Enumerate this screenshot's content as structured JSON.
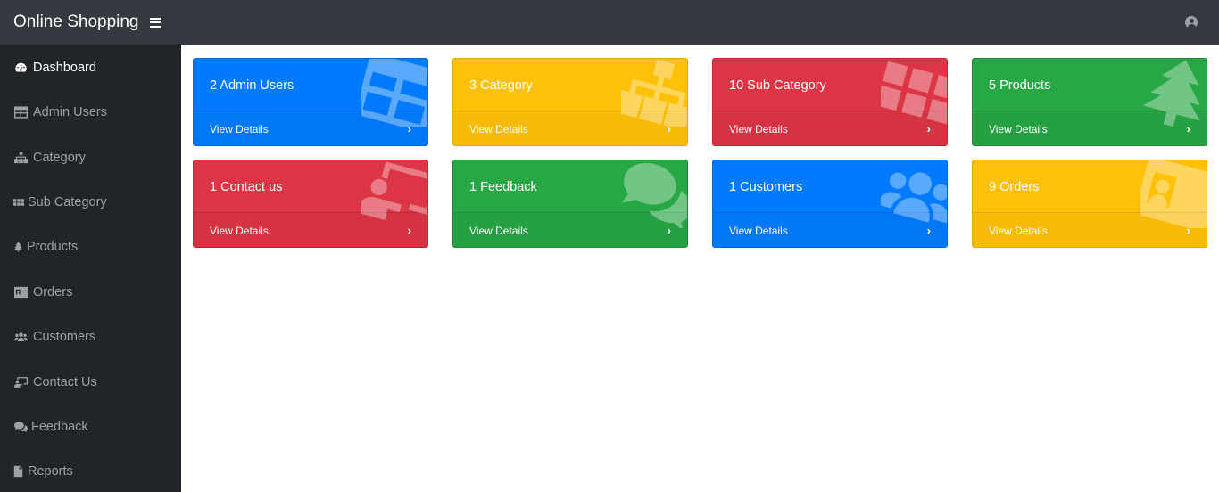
{
  "header": {
    "brand": "Online Shopping"
  },
  "sidebar": {
    "items": [
      {
        "label": "Dashboard",
        "icon": "tachometer-icon",
        "active": true
      },
      {
        "label": "Admin Users",
        "icon": "table-icon"
      },
      {
        "label": "Category",
        "icon": "sitemap-icon"
      },
      {
        "label": "Sub Category",
        "icon": "th-icon"
      },
      {
        "label": "Products",
        "icon": "tree-icon"
      },
      {
        "label": "Orders",
        "icon": "id-card-icon"
      },
      {
        "label": "Customers",
        "icon": "users-icon"
      },
      {
        "label": "Contact Us",
        "icon": "chalkboard-teacher-icon"
      },
      {
        "label": "Feedback",
        "icon": "comments-icon"
      },
      {
        "label": "Reports",
        "icon": "file-icon"
      }
    ]
  },
  "cards": [
    {
      "title": "2 Admin Users",
      "link": "View Details",
      "color": "#007bff",
      "icon": "table-icon"
    },
    {
      "title": "3 Category",
      "link": "View Details",
      "color": "#ffc107",
      "icon": "sitemap-icon"
    },
    {
      "title": "10 Sub Category",
      "link": "View Details",
      "color": "#dc3545",
      "icon": "th-icon"
    },
    {
      "title": "5 Products",
      "link": "View Details",
      "color": "#28a745",
      "icon": "tree-icon"
    },
    {
      "title": "1 Contact us",
      "link": "View Details",
      "color": "#dc3545",
      "icon": "chalkboard-teacher-icon"
    },
    {
      "title": "1 Feedback",
      "link": "View Details",
      "color": "#28a745",
      "icon": "comments-icon"
    },
    {
      "title": "1 Customers",
      "link": "View Details",
      "color": "#007bff",
      "icon": "users-icon"
    },
    {
      "title": "9 Orders",
      "link": "View Details",
      "color": "#ffc107",
      "icon": "id-card-icon"
    }
  ]
}
